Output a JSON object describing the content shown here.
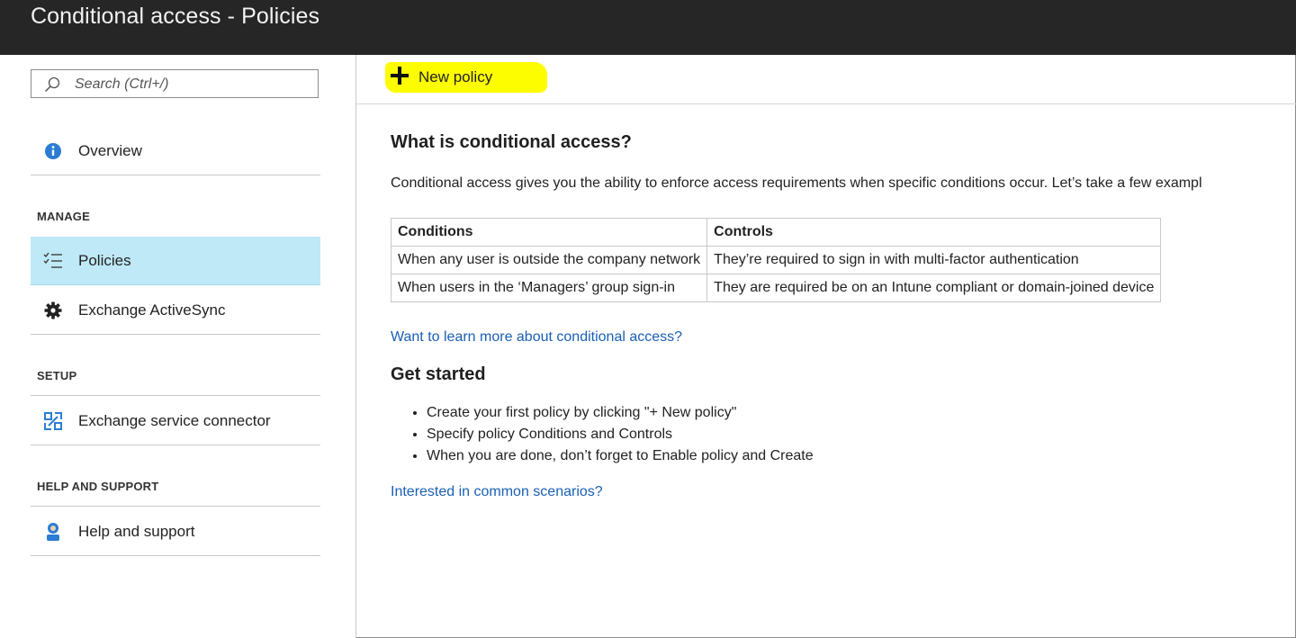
{
  "window": {
    "title": "Conditional access - Policies"
  },
  "sidebar": {
    "search": {
      "placeholder": "Search (Ctrl+/)"
    },
    "overview": {
      "label": "Overview",
      "icon": "info-icon"
    },
    "sections": {
      "manage": "MANAGE",
      "setup": "SETUP",
      "help": "HELP AND SUPPORT"
    },
    "items": {
      "policies": {
        "label": "Policies",
        "icon": "checklist-icon",
        "active": true
      },
      "activesync": {
        "label": "Exchange ActiveSync",
        "icon": "gear-icon"
      },
      "connector": {
        "label": "Exchange service connector",
        "icon": "exchange-connector-icon"
      },
      "help": {
        "label": "Help and support",
        "icon": "support-person-icon"
      }
    }
  },
  "toolbar": {
    "new_policy": "New policy",
    "highlight_color": "#fdfd00"
  },
  "main": {
    "heading": "What is conditional access?",
    "intro": "Conditional access gives you the ability to enforce access requirements when specific conditions occur. Let’s take a few exampl",
    "table": {
      "headers": [
        "Conditions",
        "Controls"
      ],
      "rows": [
        [
          "When any user is outside the company network",
          "They’re required to sign in with multi-factor authentication"
        ],
        [
          "When users in the ‘Managers’ group sign-in",
          "They are required be on an Intune compliant or domain-joined device"
        ]
      ]
    },
    "learn_more": "Want to learn more about conditional access?",
    "get_started": "Get started",
    "steps": [
      "Create your first policy by clicking \"+ New policy\"",
      "Specify policy Conditions and Controls",
      "When you are done, don’t forget to Enable policy and Create"
    ],
    "scenarios_link": "Interested in common scenarios?"
  },
  "colors": {
    "accent_link": "#1a5fb4",
    "active_nav": "#bfe9f7",
    "titlebar": "#262626"
  }
}
